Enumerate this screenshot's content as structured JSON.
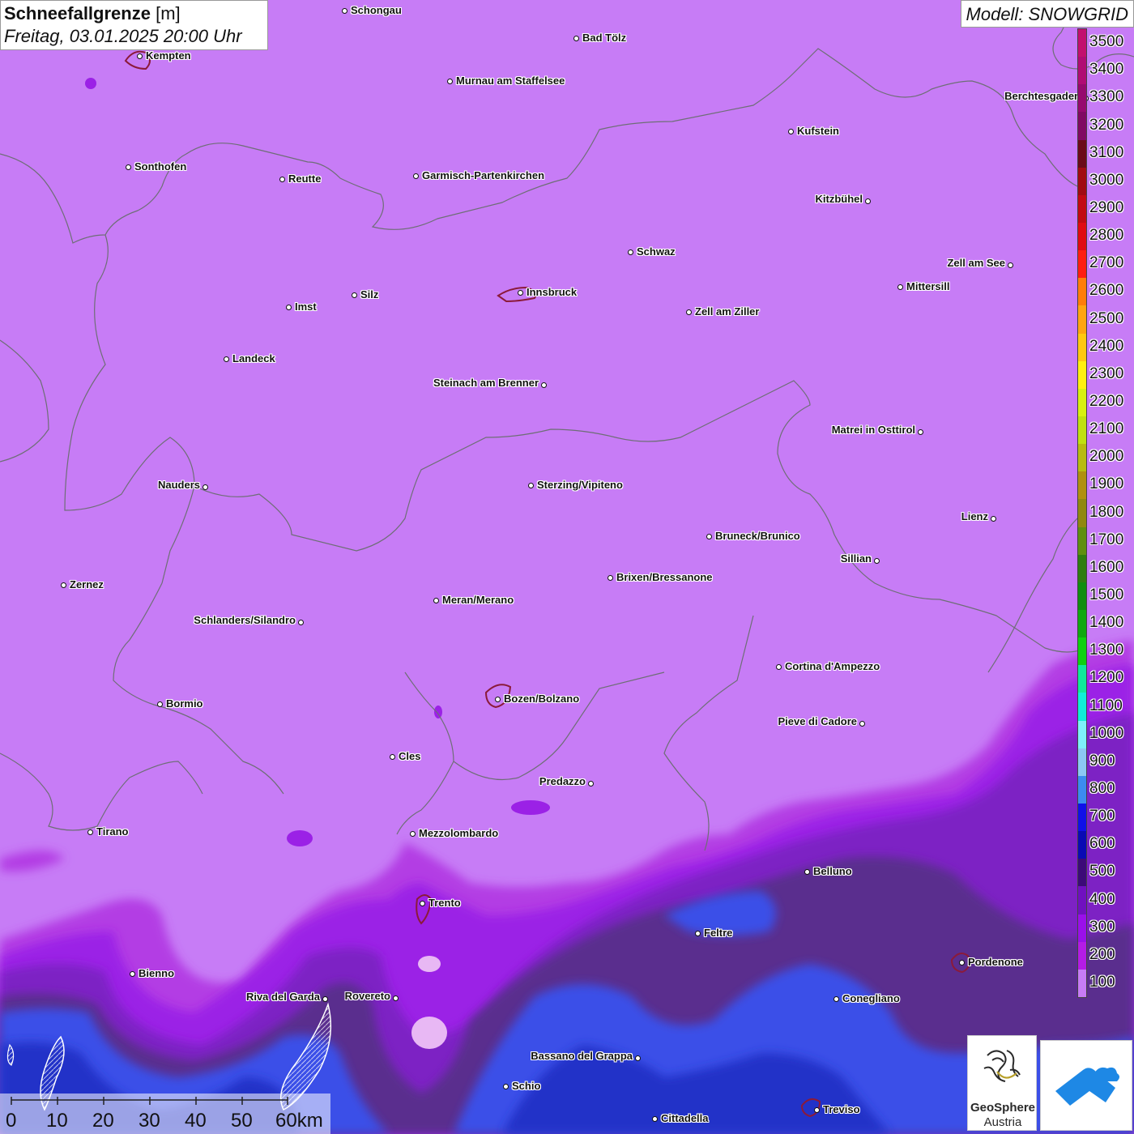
{
  "title": {
    "main": "Schneefallgrenze",
    "unit": "[m]",
    "datetime": "Freitag, 03.01.2025 20:00 Uhr"
  },
  "model": "Modell: SNOWGRID",
  "legend": {
    "labels": [
      "3500",
      "3400",
      "3300",
      "3200",
      "3100",
      "3000",
      "2900",
      "2800",
      "2700",
      "2600",
      "2500",
      "2400",
      "2300",
      "2200",
      "2100",
      "2000",
      "1900",
      "1800",
      "1700",
      "1600",
      "1500",
      "1400",
      "1300",
      "1200",
      "1100",
      "1000",
      "900",
      "800",
      "700",
      "600",
      "500",
      "400",
      "300",
      "200",
      "100"
    ],
    "colors": [
      "#c2106e",
      "#b00c74",
      "#960a6e",
      "#800a62",
      "#6b0a1a",
      "#a10b12",
      "#c20a12",
      "#e00b12",
      "#ff1e10",
      "#ff7d0a",
      "#ffa510",
      "#ffc810",
      "#fff010",
      "#d8f010",
      "#c0e010",
      "#b8bb10",
      "#b09010",
      "#908810",
      "#5f8f10",
      "#2f7d10",
      "#108d10",
      "#10a810",
      "#10d010",
      "#10e89a",
      "#10eed8",
      "#7ef0fa",
      "#8cc8f4",
      "#3c8cf0",
      "#1010e8",
      "#0a0ab4",
      "#3c0a78",
      "#7010c0",
      "#9a10ea",
      "#b41ce6",
      "#c77cf6"
    ],
    "map_colors": {
      "bg_100": "#c77cf6",
      "band_200": "#b33ee4",
      "band_300": "#9b21e6",
      "band_400": "#7d23c4",
      "band_500": "#5a2e8e",
      "band_800": "#3a4fe8",
      "band_700": "#2430c8"
    }
  },
  "cities": [
    {
      "name": "Schongau",
      "side": "r"
    },
    {
      "name": "Kempten",
      "side": "r"
    },
    {
      "name": "Bad Tölz",
      "side": "r"
    },
    {
      "name": "Murnau am Staffelsee",
      "side": "r"
    },
    {
      "name": "Berchtesgaden",
      "side": "l"
    },
    {
      "name": "Kufstein",
      "side": "r"
    },
    {
      "name": "Sonthofen",
      "side": "r"
    },
    {
      "name": "Reutte",
      "side": "r"
    },
    {
      "name": "Garmisch-Partenkirchen",
      "side": "r"
    },
    {
      "name": "Kitzbühel",
      "side": "l"
    },
    {
      "name": "Schwaz",
      "side": "r"
    },
    {
      "name": "Zell am See",
      "side": "l"
    },
    {
      "name": "Mittersill",
      "side": "r"
    },
    {
      "name": "Innsbruck",
      "side": "r"
    },
    {
      "name": "Silz",
      "side": "r"
    },
    {
      "name": "Imst",
      "side": "r"
    },
    {
      "name": "Zell am Ziller",
      "side": "r"
    },
    {
      "name": "Landeck",
      "side": "r"
    },
    {
      "name": "Steinach am Brenner",
      "side": "l"
    },
    {
      "name": "Matrei in Osttirol",
      "side": "l"
    },
    {
      "name": "Nauders",
      "side": "l"
    },
    {
      "name": "Sterzing/Vipiteno",
      "side": "r"
    },
    {
      "name": "Lienz",
      "side": "l"
    },
    {
      "name": "Bruneck/Brunico",
      "side": "r"
    },
    {
      "name": "Sillian",
      "side": "l"
    },
    {
      "name": "Zernez",
      "side": "r"
    },
    {
      "name": "Brixen/Bressanone",
      "side": "r"
    },
    {
      "name": "Meran/Merano",
      "side": "r"
    },
    {
      "name": "Schlanders/Silandro",
      "side": "l"
    },
    {
      "name": "Cortina d'Ampezzo",
      "side": "r"
    },
    {
      "name": "Bozen/Bolzano",
      "side": "r"
    },
    {
      "name": "Bormio",
      "side": "r"
    },
    {
      "name": "Pieve di Cadore",
      "side": "l"
    },
    {
      "name": "Cles",
      "side": "r"
    },
    {
      "name": "Predazzo",
      "side": "l"
    },
    {
      "name": "Tirano",
      "side": "r"
    },
    {
      "name": "Mezzolombardo",
      "side": "r"
    },
    {
      "name": "Belluno",
      "side": "r"
    },
    {
      "name": "Trento",
      "side": "r"
    },
    {
      "name": "Feltre",
      "side": "r"
    },
    {
      "name": "Pordenone",
      "side": "r"
    },
    {
      "name": "Bienno",
      "side": "r"
    },
    {
      "name": "Riva del Garda",
      "side": "l"
    },
    {
      "name": "Rovereto",
      "side": "l"
    },
    {
      "name": "Conegliano",
      "side": "r"
    },
    {
      "name": "Bassano del Grappa",
      "side": "l"
    },
    {
      "name": "Schio",
      "side": "r"
    },
    {
      "name": "Treviso",
      "side": "r"
    },
    {
      "name": "Cittadella",
      "side": "r"
    }
  ],
  "scale": {
    "labels": [
      "0",
      "10",
      "20",
      "30",
      "40",
      "50",
      "60km"
    ]
  },
  "logos": {
    "geosphere_line1": "GeoSphere",
    "geosphere_line2": "Austria",
    "geosphere_color": "#2a2a2a",
    "second_logo_color": "#1e88e5"
  }
}
